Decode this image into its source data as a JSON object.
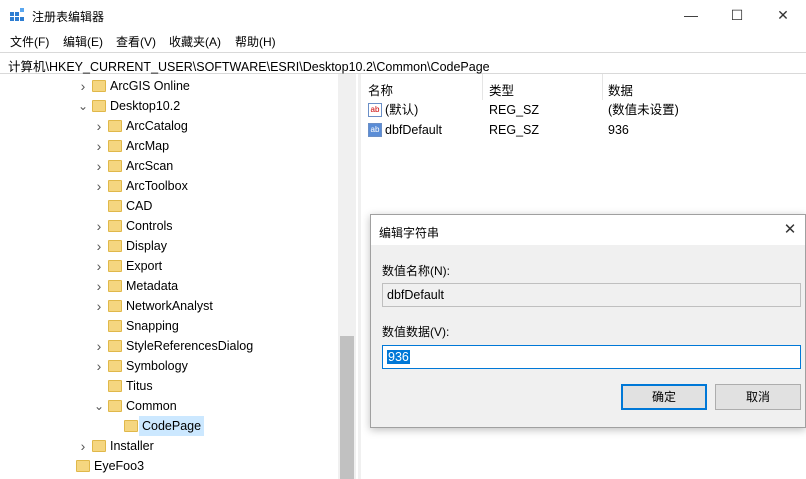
{
  "window": {
    "title": "注册表编辑器",
    "minimize": "—",
    "maximize": "☐",
    "close": "✕"
  },
  "menu": [
    "文件(F)",
    "编辑(E)",
    "查看(V)",
    "收藏夹(A)",
    "帮助(H)"
  ],
  "address": "计算机\\HKEY_CURRENT_USER\\SOFTWARE\\ESRI\\Desktop10.2\\Common\\CodePage",
  "tree": [
    {
      "label": "ArcGIS Online",
      "expander": "collapsed"
    },
    {
      "label": "Desktop10.2",
      "expander": "expanded"
    },
    {
      "label": "ArcCatalog",
      "expander": "collapsed"
    },
    {
      "label": "ArcMap",
      "expander": "collapsed"
    },
    {
      "label": "ArcScan",
      "expander": "collapsed"
    },
    {
      "label": "ArcToolbox",
      "expander": "collapsed"
    },
    {
      "label": "CAD",
      "expander": "none"
    },
    {
      "label": "Controls",
      "expander": "collapsed"
    },
    {
      "label": "Display",
      "expander": "collapsed"
    },
    {
      "label": "Export",
      "expander": "collapsed"
    },
    {
      "label": "Metadata",
      "expander": "collapsed"
    },
    {
      "label": "NetworkAnalyst",
      "expander": "collapsed"
    },
    {
      "label": "Snapping",
      "expander": "none"
    },
    {
      "label": "StyleReferencesDialog",
      "expander": "collapsed"
    },
    {
      "label": "Symbology",
      "expander": "collapsed"
    },
    {
      "label": "Titus",
      "expander": "none"
    },
    {
      "label": "Common",
      "expander": "expanded"
    },
    {
      "label": "CodePage",
      "expander": "none",
      "selected": true
    },
    {
      "label": "Installer",
      "expander": "collapsed"
    },
    {
      "label": "EyeFoo3",
      "expander": "none"
    }
  ],
  "list": {
    "headers": {
      "name": "名称",
      "type": "类型",
      "data": "数据"
    },
    "rows": [
      {
        "icon": "string-value-icon",
        "name": "(默认)",
        "type": "REG_SZ",
        "data": "(数值未设置)"
      },
      {
        "icon": "binary-value-icon",
        "name": "dbfDefault",
        "type": "REG_SZ",
        "data": "936"
      }
    ]
  },
  "dialog": {
    "title": "编辑字符串",
    "close": "✕",
    "name_label": "数值名称(N):",
    "name_value": "dbfDefault",
    "data_label": "数值数据(V):",
    "data_value": "936",
    "ok": "确定",
    "cancel": "取消"
  }
}
